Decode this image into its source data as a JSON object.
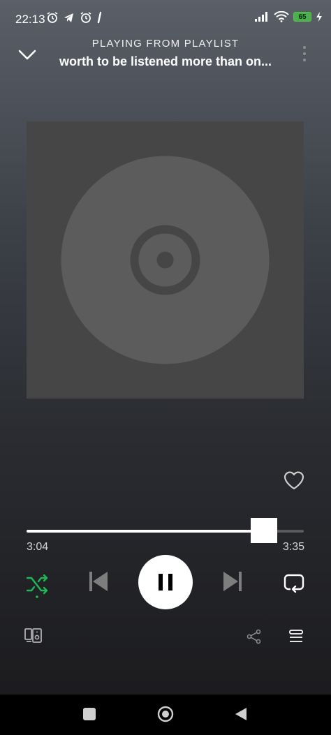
{
  "status_bar": {
    "time": "22:13",
    "left_icons": [
      "alarm-icon",
      "telegram-icon",
      "alarm-icon",
      "notification-icon"
    ],
    "right_icons": [
      "sim-silent-icon",
      "signal-icon",
      "wifi-icon",
      "battery-icon",
      "charging-icon"
    ],
    "battery_level": "65"
  },
  "header": {
    "subtitle": "PLAYING FROM PLAYLIST",
    "title": "worth to be listened more than on..."
  },
  "player": {
    "elapsed": "3:04",
    "duration": "3:35",
    "progress_fraction": 0.856,
    "shuffle_active": true,
    "liked": false
  },
  "colors": {
    "accent": "#1db954",
    "artwork_bg": "#464646",
    "disc": "#5c5c5c"
  },
  "nav": {
    "icons": [
      "recents-square-icon",
      "home-circle-icon",
      "back-triangle-icon"
    ]
  }
}
